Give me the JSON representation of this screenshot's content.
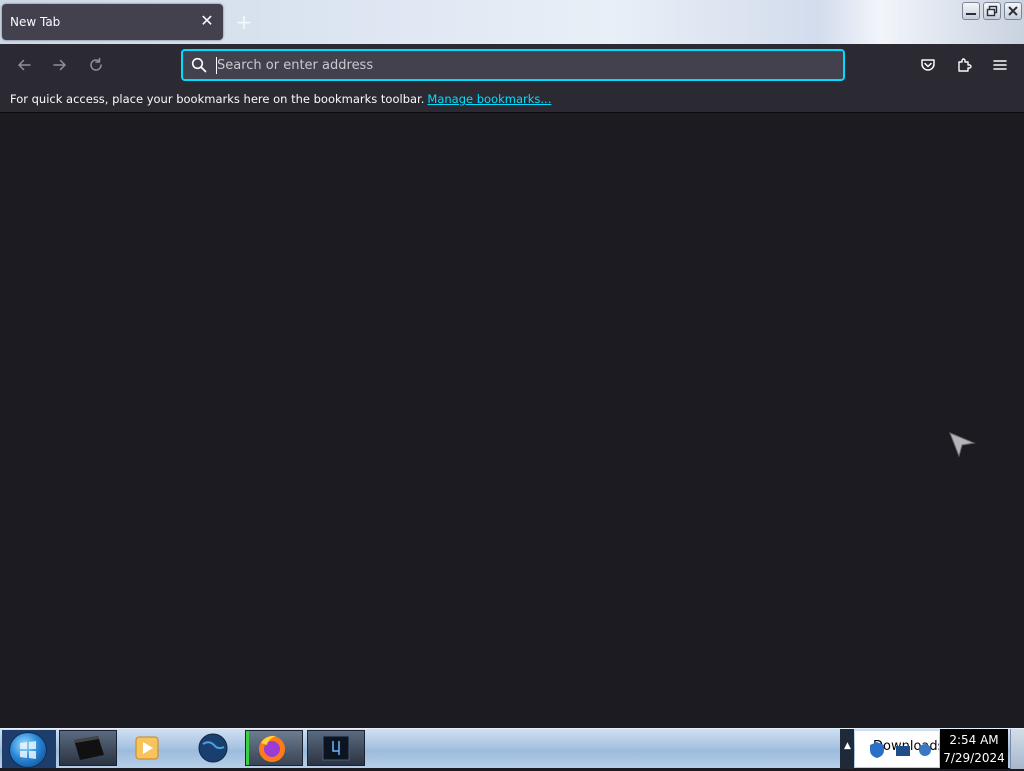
{
  "browser": {
    "tab": {
      "title": "New Tab",
      "close_glyph": "✕"
    },
    "new_tab_glyph": "+",
    "urlbar": {
      "placeholder": "Search or enter address",
      "value": ""
    },
    "toolbar_icons": [
      "back-arrow-icon",
      "forward-arrow-icon",
      "reload-icon",
      "pocket-icon",
      "extensions-icon",
      "hamburger-menu-icon"
    ],
    "bookmarks_bar": {
      "message": "For quick access, place your bookmarks here on the bookmarks toolbar.",
      "link": "Manage bookmarks..."
    },
    "accent_color": "#00ddff"
  },
  "window_controls": [
    "minimize-icon",
    "restore-icon",
    "close-icon"
  ],
  "taskbar": {
    "items": [
      "start-orb-icon",
      "terminal-app-icon",
      "media-player-icon",
      "globe-app-icon",
      "firefox-icon",
      "monitor-app-icon"
    ],
    "tray": {
      "downloads_label": "Downloads"
    },
    "clock": {
      "time": "2:54 AM",
      "date": "7/29/2024"
    }
  }
}
